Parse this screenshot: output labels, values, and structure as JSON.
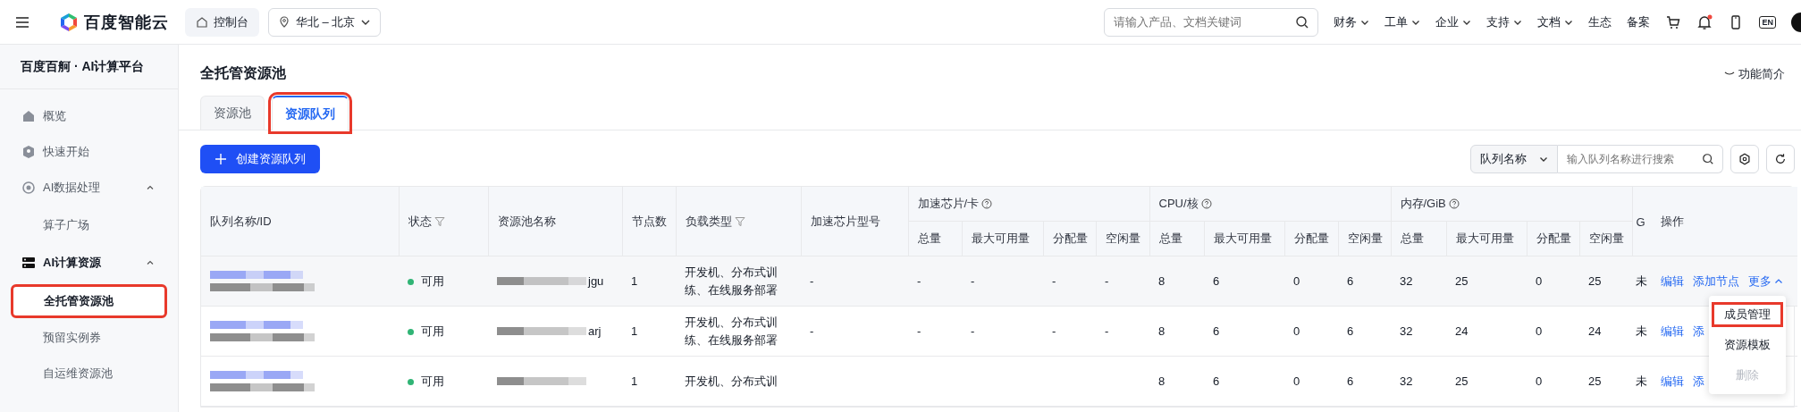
{
  "topbar": {
    "logo": "百度智能云",
    "console": "控制台",
    "region": "华北 – 北京",
    "search": {
      "placeholder": "请输入产品、文档关键词"
    },
    "nav": [
      {
        "label": "财务",
        "dropdown": true
      },
      {
        "label": "工单",
        "dropdown": true
      },
      {
        "label": "企业",
        "dropdown": true
      },
      {
        "label": "支持",
        "dropdown": true
      },
      {
        "label": "文档",
        "dropdown": true
      },
      {
        "label": "生态",
        "dropdown": false
      },
      {
        "label": "备案",
        "dropdown": false
      }
    ],
    "notification_dot": true,
    "language": "EN"
  },
  "sidebar": {
    "title": "百度百舸 · AI计算平台",
    "items": [
      {
        "kind": "link",
        "label": "概览",
        "selected": false
      },
      {
        "kind": "link",
        "label": "快速开始",
        "selected": false
      },
      {
        "kind": "group",
        "label": "AI数据处理",
        "selected": false,
        "expanded": true,
        "children": [
          {
            "label": "算子广场",
            "selected": false,
            "highlighted": false
          }
        ]
      },
      {
        "kind": "group",
        "label": "AI计算资源",
        "selected": true,
        "expanded": true,
        "children": [
          {
            "label": "全托管资源池",
            "selected": true,
            "highlighted": true
          },
          {
            "label": "预留实例券",
            "selected": false,
            "highlighted": false
          },
          {
            "label": "自运维资源池",
            "selected": false,
            "highlighted": false
          }
        ]
      }
    ]
  },
  "page": {
    "title": "全托管资源池",
    "intro_link": "功能简介",
    "tabs": [
      {
        "label": "资源池",
        "selected": false,
        "highlighted": false
      },
      {
        "label": "资源队列",
        "selected": true,
        "highlighted": true
      }
    ],
    "create_button": "创建资源队列",
    "filter": {
      "field": "队列名称",
      "placeholder": "输入队列名称进行搜索"
    }
  },
  "table": {
    "columns": [
      {
        "label": "队列名称/ID",
        "filter": false,
        "help": false
      },
      {
        "label": "状态",
        "filter": true,
        "help": false
      },
      {
        "label": "资源池名称",
        "filter": false,
        "help": false
      },
      {
        "label": "节点数",
        "filter": false,
        "help": false
      },
      {
        "label": "负载类型",
        "filter": true,
        "help": false
      },
      {
        "label": "加速芯片型号",
        "filter": false,
        "help": false
      },
      {
        "label": "加速芯片/卡",
        "filter": false,
        "help": true,
        "children": [
          "总量",
          "最大可用量",
          "分配量",
          "空闲量"
        ]
      },
      {
        "label": "CPU/核",
        "filter": false,
        "help": true,
        "children": [
          "总量",
          "最大可用量",
          "分配量",
          "空闲量"
        ]
      },
      {
        "label": "内存/GiB",
        "filter": false,
        "help": true,
        "children": [
          "总量",
          "最大可用量",
          "分配量",
          "空闲量"
        ]
      },
      {
        "label": "G",
        "filter": false,
        "help": false
      },
      {
        "label": "操作",
        "filter": false,
        "help": false
      }
    ],
    "rows": [
      {
        "status": "可用",
        "color": "#30b475",
        "pool_suffix": "jgu",
        "nodes": "1",
        "workload": "开发机、分布式训练、在线服务部署",
        "chip_model": "-",
        "chip": [
          "-",
          "-",
          "-",
          "-"
        ],
        "cpu": [
          "8",
          "6",
          "0",
          "6"
        ],
        "memory": [
          "32",
          "25",
          "0",
          "25"
        ],
        "g": "未",
        "actions": [
          {
            "kind": "link",
            "label": "编辑"
          },
          {
            "kind": "link",
            "label": "添加节点"
          },
          {
            "kind": "menu",
            "label": "更多",
            "expanded": true,
            "items": [
              {
                "label": "成员管理",
                "disabled": false,
                "highlighted": true
              },
              {
                "label": "资源模板",
                "disabled": false,
                "highlighted": false
              },
              {
                "label": "删除",
                "disabled": true,
                "highlighted": false
              }
            ]
          }
        ]
      },
      {
        "status": "可用",
        "color": "#30b475",
        "pool_suffix": "arj",
        "nodes": "1",
        "workload": "开发机、分布式训练、在线服务部署",
        "chip_model": "-",
        "chip": [
          "-",
          "-",
          "-",
          "-"
        ],
        "cpu": [
          "8",
          "6",
          "0",
          "6"
        ],
        "memory": [
          "32",
          "24",
          "0",
          "24"
        ],
        "g": "未",
        "actions": [
          {
            "kind": "link",
            "label": "编辑"
          },
          {
            "kind": "link",
            "label": "添"
          }
        ]
      },
      {
        "status": "可用",
        "color": "#30b475",
        "nodes": "1",
        "workload": "开发机、分布式训",
        "cpu": [
          "8",
          "6",
          "0",
          "6"
        ],
        "memory": [
          "32",
          "25",
          "0",
          "25"
        ],
        "g": "未",
        "actions": [
          {
            "kind": "link",
            "label": "编辑"
          },
          {
            "kind": "link",
            "label": "添"
          }
        ]
      }
    ]
  }
}
